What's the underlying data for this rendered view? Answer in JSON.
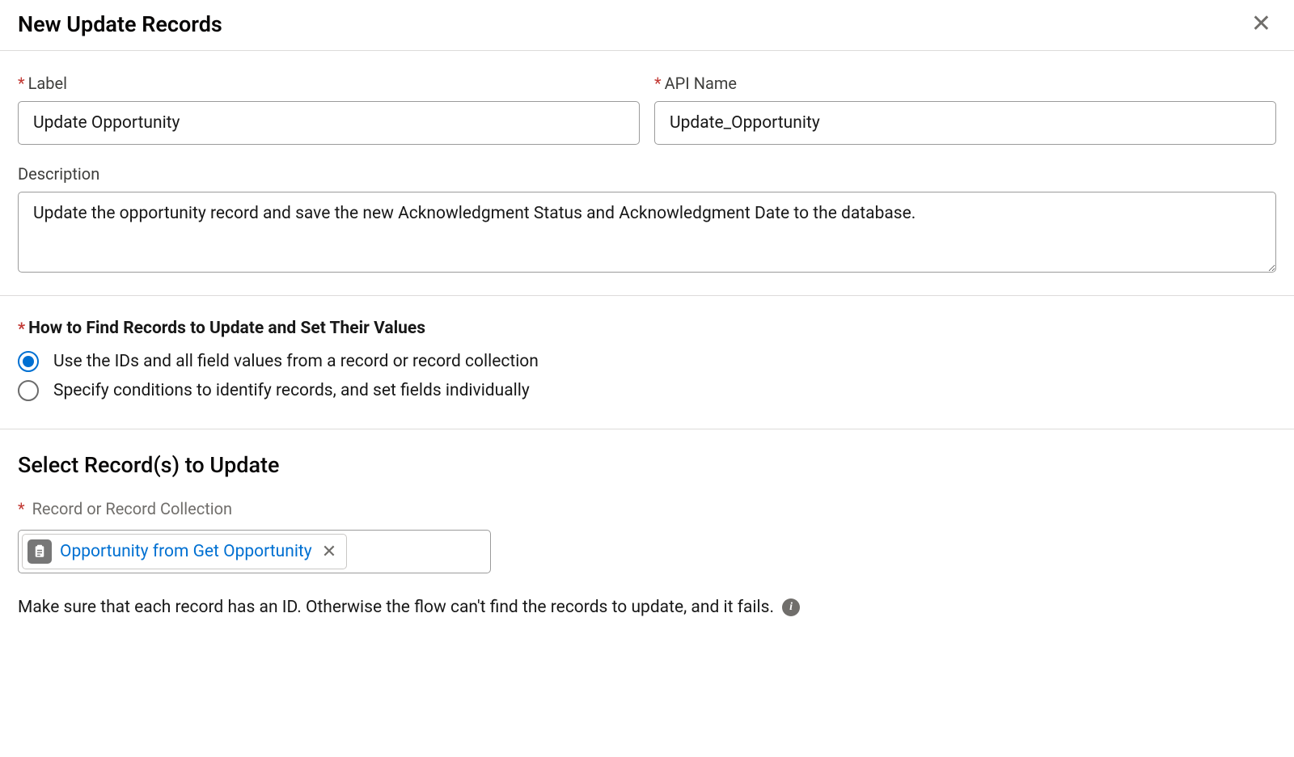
{
  "modal": {
    "title": "New Update Records"
  },
  "fields": {
    "label_label": "Label",
    "label_value": "Update Opportunity",
    "api_name_label": "API Name",
    "api_name_value": "Update_Opportunity",
    "description_label": "Description",
    "description_value": "Update the opportunity record and save the new Acknowledgment Status and Acknowledgment Date to the database."
  },
  "find_records": {
    "question": "How to Find Records to Update and Set Their Values",
    "option1": "Use the IDs and all field values from a record or record collection",
    "option2": "Specify conditions to identify records, and set fields individually",
    "selected": "option1"
  },
  "select_records": {
    "heading": "Select Record(s) to Update",
    "field_label": "Record or Record Collection",
    "pill_text": "Opportunity from Get Opportunity",
    "help_text": "Make sure that each record has an ID. Otherwise the flow can't find the records to update, and it fails."
  }
}
